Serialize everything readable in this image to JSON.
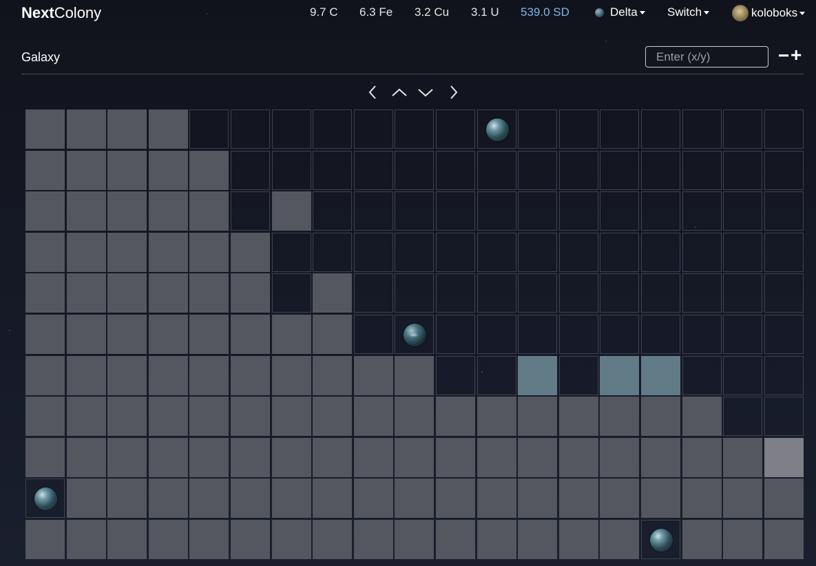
{
  "app": {
    "brand_bold": "Next",
    "brand_rest": "Colony"
  },
  "resources": {
    "coal": "9.7 C",
    "ore": "6.3 Fe",
    "copper": "3.2 Cu",
    "uranium": "3.1 U",
    "stardust": "539.0 SD",
    "stardust_color": "#7fb6e6"
  },
  "nav": {
    "planet": "Delta",
    "switch": "Switch",
    "user": "koloboks"
  },
  "header": {
    "title": "Galaxy",
    "coord_placeholder": "Enter (x/y)",
    "zoom_out": "−",
    "zoom_in": "+"
  },
  "navigation_arrows": [
    "left-arrow-icon",
    "up-arrow-icon",
    "down-arrow-icon",
    "right-arrow-icon"
  ],
  "legend_colors": {
    "explored": "#54575f",
    "explored_blue": "#617b87",
    "explored_light": "#7e7f87",
    "unexplored_border": "#3d4250"
  },
  "grid": {
    "columns": 19,
    "rows": [
      "FFFF.......P.......",
      "FFFFF..............",
      "FFFFF.F............",
      "FFFFFF.............",
      "FFFFFF.F...........",
      "FFFFFFFF.P.........",
      "FFFFFFFFFF..B.BB...",
      "FFFFFFFFFFFFFFFFF..",
      "FFFFFFFFFFFFFFFFFFL",
      "PFFFFFFFFFFFFFFFFFF",
      "FFFFFFFFFFFFFFFPFFF"
    ],
    "planet_styles": {
      "0-11": "smooth",
      "5-9": "cloudy",
      "9-0": "smooth",
      "10-15": "smooth"
    }
  }
}
